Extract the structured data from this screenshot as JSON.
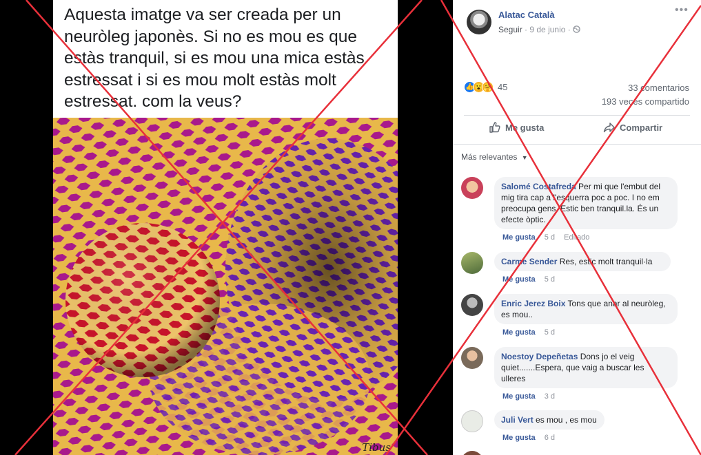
{
  "post": {
    "caption": "Aquesta imatge va ser creada per un neuròleg japonès.  Si no es mou es que estàs tranquil,  si es mou una mica estàs estressat i si es mou molt estàs molt estressat. com la veus?",
    "image_watermark": "Tibus",
    "author": "Alatac Català",
    "follow_label": "Seguir",
    "date": "9 de junio",
    "separator": "·",
    "privacy_icon": "globe-icon",
    "more_icon": "more-dots-icon"
  },
  "stats": {
    "reaction_count": "45",
    "reaction_icons": [
      "like-icon",
      "wow-icon",
      "care-icon"
    ],
    "comments": "33 comentarios",
    "shares": "193 veces compartido"
  },
  "actions": {
    "like_label": "Me gusta",
    "share_label": "Compartir"
  },
  "comments_section": {
    "sort_label": "Más relevantes",
    "like_label": "Me gusta",
    "items": [
      {
        "author": "Salomé Costafreda",
        "text": "Per mi que l'embut del mig tira cap a l'esquerra poc a poc. I no em preocupa gens. Estic ben tranquil.la. És un efecte òptic.",
        "time": "5 d",
        "edited": "Editado",
        "avatar_color": "#c9415a"
      },
      {
        "author": "Carme Sender",
        "text": "Res, estic molt tranquil·la",
        "time": "5 d",
        "edited": "",
        "avatar_color": "#6f8a4a"
      },
      {
        "author": "Enric Jerez Boix",
        "text": "Tons que anar al neuròleg, es mou..",
        "time": "5 d",
        "edited": "",
        "avatar_color": "#5a5a5a"
      },
      {
        "author": "Noestoy Depeñetas",
        "text": "Dons jo el veig quiet.......Espera, que vaig a buscar les ulleres",
        "time": "3 d",
        "edited": "",
        "avatar_color": "#7a6a5a"
      },
      {
        "author": "Juli Vert",
        "text": "es mou , es mou",
        "time": "6 d",
        "edited": "",
        "avatar_color": "#e9ece6"
      }
    ]
  },
  "colors": {
    "link": "#385898",
    "bubble": "#f2f3f5",
    "cross": "#e8303a",
    "illusion_magenta": "#a8198c",
    "illusion_purple": "#6a23b5",
    "illusion_gold": "#e8b84a",
    "illusion_red": "#c9132a"
  }
}
